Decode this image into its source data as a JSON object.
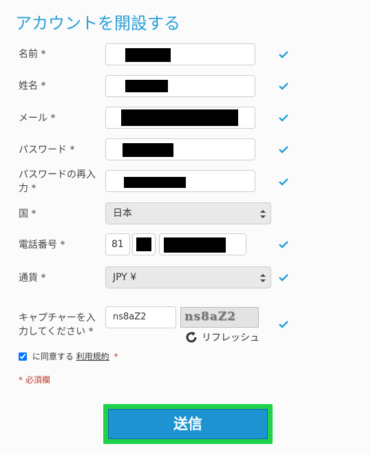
{
  "page": {
    "title": "アカウントを開設する"
  },
  "form": {
    "first_name": {
      "label": "名前 *"
    },
    "last_name": {
      "label": "姓名 *"
    },
    "email": {
      "label": "メール *"
    },
    "password": {
      "label": "パスワード *"
    },
    "password_confirm": {
      "label_line1": "パスワードの再入",
      "label_line2": "力 *"
    },
    "country": {
      "label": "国 *",
      "value": "日本"
    },
    "phone": {
      "label": "電話番号 *",
      "code": "81"
    },
    "currency": {
      "label": "通貨 *",
      "value": "JPY ¥"
    },
    "captcha": {
      "label_line1": "キャプチャーを入",
      "label_line2": "力してください *",
      "value": "ns8aZ2",
      "image_text": "ns8aZ2",
      "refresh_label": "リフレッシュ"
    },
    "terms": {
      "prefix": "に同意する",
      "link": "利用規約",
      "required_mark": "*",
      "checked": true
    },
    "required_note": "* 必須欄",
    "submit_label": "送信"
  },
  "colors": {
    "accent": "#2a9fd6",
    "submit_bg": "#1e93d2",
    "highlight": "#1ed34b",
    "required": "#c0392b"
  },
  "icons": {
    "valid": "check-icon",
    "refresh": "refresh-icon",
    "select": "select-arrows-icon"
  }
}
